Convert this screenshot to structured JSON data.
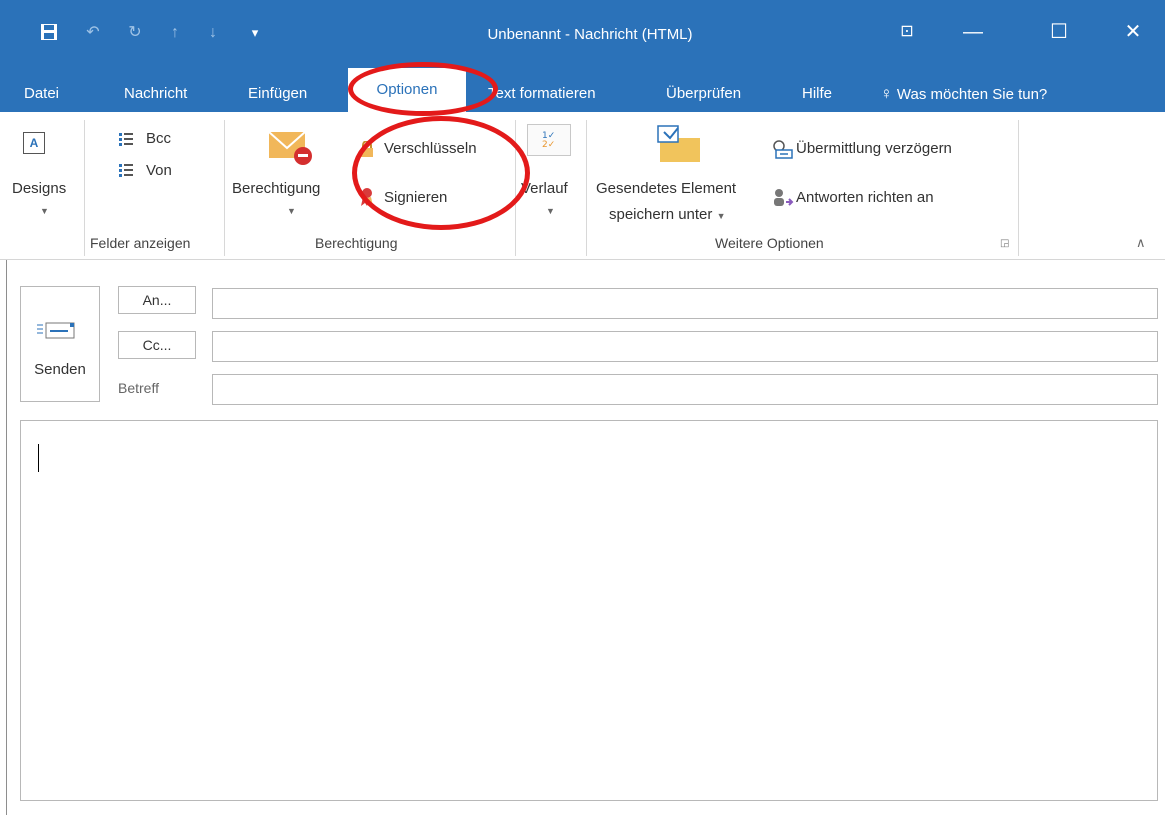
{
  "window": {
    "title": "Unbenannt - Nachricht (HTML)",
    "controls": {
      "ribbon_display": "⊡",
      "minimize": "—",
      "maximize": "☐",
      "close": "✕"
    }
  },
  "quick_access": [
    "save-icon",
    "undo-icon",
    "redo-icon",
    "up-arrow-icon",
    "down-arrow-icon",
    "customize-icon"
  ],
  "tabs": [
    "Datei",
    "Nachricht",
    "Einfügen",
    "Optionen",
    "Text formatieren",
    "Überprüfen",
    "Hilfe"
  ],
  "active_tab": "Optionen",
  "tell_me": "Was möchten Sie tun?",
  "ribbon": {
    "designs": "Designs",
    "bcc": "Bcc",
    "von": "Von",
    "felder_anzeigen": "Felder anzeigen",
    "berechtigung_btn": "Berechtigung",
    "verschluesseln": "Verschlüsseln",
    "signieren": "Signieren",
    "berechtigung_group": "Berechtigung",
    "verlauf": "Verlauf",
    "gesendetes_1": "Gesendetes Element",
    "gesendetes_2": "speichern unter",
    "uebermittlung": "Übermittlung verzögern",
    "antworten": "Antworten richten an",
    "weitere_optionen": "Weitere Optionen"
  },
  "compose": {
    "send": "Senden",
    "to": "An...",
    "cc": "Cc...",
    "subject_label": "Betreff",
    "to_value": "",
    "cc_value": "",
    "subject_value": "",
    "body_value": ""
  },
  "colors": {
    "accent": "#2b72b9",
    "annotation": "#e31a1a"
  }
}
